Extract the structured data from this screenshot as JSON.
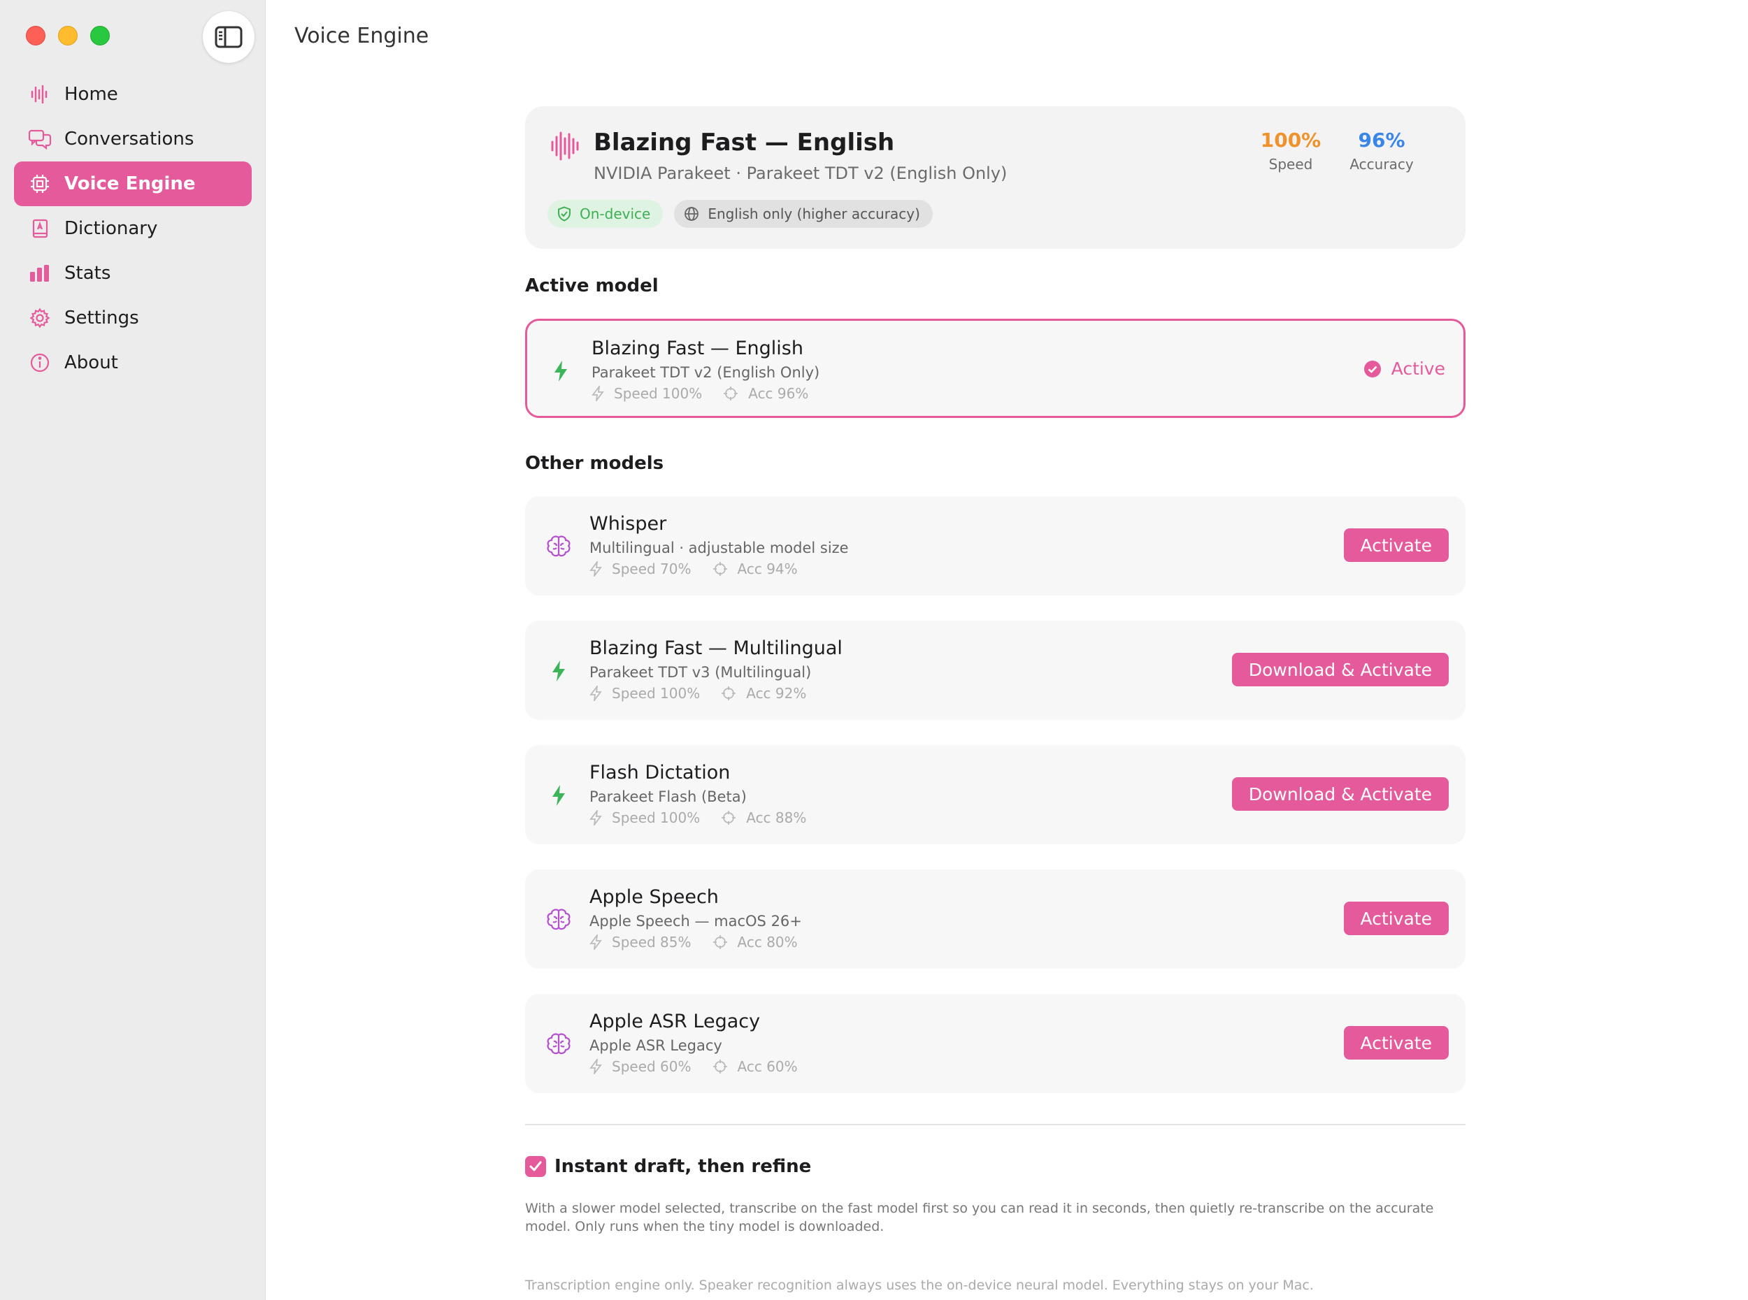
{
  "sidebar": {
    "items": [
      {
        "label": "Home",
        "icon": "waveform-icon"
      },
      {
        "label": "Conversations",
        "icon": "chat-bubbles-icon"
      },
      {
        "label": "Voice Engine",
        "icon": "chip-icon",
        "active": true
      },
      {
        "label": "Dictionary",
        "icon": "book-icon"
      },
      {
        "label": "Stats",
        "icon": "bar-chart-icon"
      },
      {
        "label": "Settings",
        "icon": "gear-icon"
      },
      {
        "label": "About",
        "icon": "info-icon"
      }
    ]
  },
  "header": {
    "title": "Voice Engine"
  },
  "hero": {
    "name": "Blazing Fast — English",
    "subtitle": "NVIDIA Parakeet · Parakeet TDT v2 (English Only)",
    "speed_value": "100%",
    "speed_label": "Speed",
    "accuracy_value": "96%",
    "accuracy_label": "Accuracy",
    "chip_device": "On-device",
    "chip_language": "English only (higher accuracy)"
  },
  "active_section": {
    "heading": "Active model",
    "model": {
      "name": "Blazing Fast — English",
      "subtitle": "Parakeet TDT v2 (English Only)",
      "speed": "Speed 100%",
      "acc": "Acc 96%",
      "status": "Active"
    }
  },
  "other_section": {
    "heading": "Other models",
    "models": [
      {
        "name": "Whisper",
        "subtitle": "Multilingual · adjustable model size",
        "speed": "Speed 70%",
        "acc": "Acc 94%",
        "action": "Activate",
        "icon": "brain-icon"
      },
      {
        "name": "Blazing Fast — Multilingual",
        "subtitle": "Parakeet TDT v3 (Multilingual)",
        "speed": "Speed 100%",
        "acc": "Acc 92%",
        "action": "Download & Activate",
        "icon": "bolt-icon"
      },
      {
        "name": "Flash Dictation",
        "subtitle": "Parakeet Flash (Beta)",
        "speed": "Speed 100%",
        "acc": "Acc 88%",
        "action": "Download & Activate",
        "icon": "bolt-icon"
      },
      {
        "name": "Apple Speech",
        "subtitle": "Apple Speech — macOS 26+",
        "speed": "Speed 85%",
        "acc": "Acc 80%",
        "action": "Activate",
        "icon": "brain-icon"
      },
      {
        "name": "Apple ASR Legacy",
        "subtitle": "Apple ASR Legacy",
        "speed": "Speed 60%",
        "acc": "Acc 60%",
        "action": "Activate",
        "icon": "brain-icon"
      }
    ]
  },
  "instant_draft": {
    "label": "Instant draft, then refine",
    "checked": true,
    "description": "With a slower model selected, transcribe on the fast model first so you can read it in seconds, then quietly re-transcribe on the accurate model. Only runs when the tiny model is downloaded."
  },
  "footer_note": "Transcription engine only. Speaker recognition always uses the on-device neural model. Everything stays on your Mac.",
  "colors": {
    "accent": "#e55a9b",
    "speed": "#f0922b",
    "accuracy": "#3a86e8",
    "bolt": "#3cb55a",
    "brain": "#b44fd0"
  }
}
